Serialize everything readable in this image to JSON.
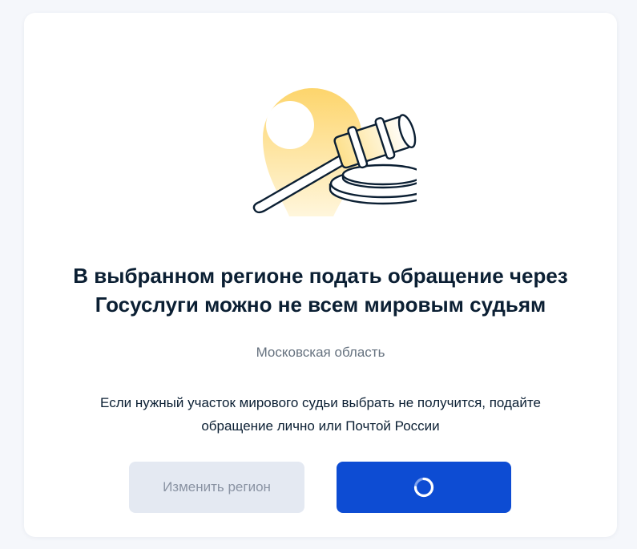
{
  "dialog": {
    "title_line1": "В выбранном регионе подать обращение через",
    "title_line2": "Госуслуги можно не всем мировым судьям",
    "region": "Московская область",
    "note_line1": "Если нужный участок мирового судьи выбрать не получится, подайте",
    "note_line2": "обращение лично или Почтой России",
    "illustration": "location-pin-with-gavel-icon"
  },
  "buttons": {
    "change_region_label": "Изменить регион",
    "continue_state": "loading"
  },
  "colors": {
    "background": "#f5f7fb",
    "card": "#ffffff",
    "title_text": "#0b1f33",
    "muted_text": "#66727f",
    "primary_button": "#0d4cd3",
    "secondary_button": "#e4e9f2",
    "secondary_button_text": "#8a93a3",
    "pin_gradient_top": "#fdd56c",
    "pin_gradient_bottom": "#fff6dc"
  }
}
